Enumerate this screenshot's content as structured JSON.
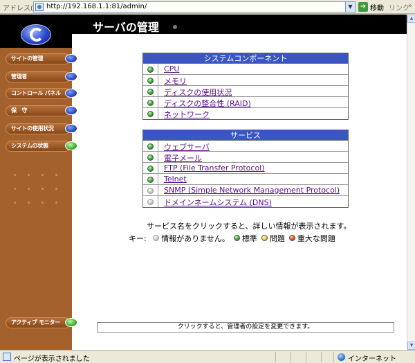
{
  "browser": {
    "address_label": "アドレス(D)",
    "url": "http://192.168.1.1:81/admin/",
    "go_label": "移動",
    "links_label": "リンク",
    "links_chevron": "»"
  },
  "header": {
    "title": "サーバの管理"
  },
  "sidebar": {
    "items": [
      {
        "label": "サイトの管理",
        "state": "normal"
      },
      {
        "label": "管理者",
        "state": "normal"
      },
      {
        "label": "コントロール パネル",
        "state": "normal"
      },
      {
        "label": "保　守",
        "state": "normal"
      },
      {
        "label": "サイトの使用状況",
        "state": "normal"
      },
      {
        "label": "システムの状態",
        "state": "active"
      }
    ],
    "monitor_label": "アクティブ モニター"
  },
  "components": {
    "title": "システムコンポーネント",
    "rows": [
      {
        "label": "CPU",
        "status": "green"
      },
      {
        "label": "メモリ",
        "status": "green"
      },
      {
        "label": "ディスクの使用状況",
        "status": "green"
      },
      {
        "label": "ディスクの整合性 (RAID)",
        "status": "green"
      },
      {
        "label": "ネットワーク",
        "status": "green"
      }
    ]
  },
  "services": {
    "title": "サービス",
    "rows": [
      {
        "label": "ウェブサーバ",
        "status": "green"
      },
      {
        "label": "電子メール",
        "status": "green"
      },
      {
        "label": "FTP (File Transfer Protocol)",
        "status": "green"
      },
      {
        "label": "Telnet",
        "status": "green"
      },
      {
        "label": "SNMP (Simple Network Management Protocol)",
        "status": "grey"
      },
      {
        "label": "ドメインネームシステム (DNS)",
        "status": "grey"
      }
    ]
  },
  "legend": {
    "hint": "サービス名をクリックすると、詳しい情報が表示されます。",
    "key_label": "キー:",
    "items": [
      {
        "label": "情報がありません。",
        "status": "grey"
      },
      {
        "label": "標準",
        "status": "green"
      },
      {
        "label": "問題",
        "status": "yellow"
      },
      {
        "label": "重大な問題",
        "status": "red"
      }
    ]
  },
  "notice": "クリックすると、管理者の設定を変更できます。",
  "status": {
    "text": "ページが表示されました",
    "zone": "インターネット"
  },
  "colors": {
    "sidebar": "#a3612d",
    "header": "#000000",
    "table_header": "#3a56c5",
    "link": "#5a0c8c"
  }
}
